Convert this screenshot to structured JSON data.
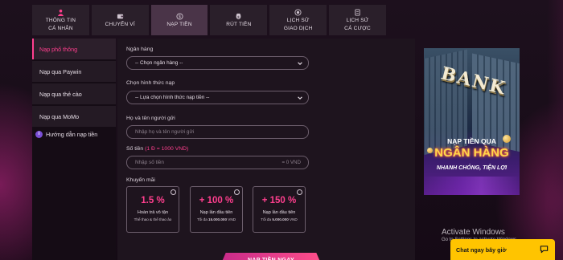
{
  "tabs": [
    {
      "icon": "user-icon",
      "label_line1": "THÔNG TIN",
      "label_line2": "CÁ NHÂN",
      "active": false
    },
    {
      "icon": "wallet-icon",
      "label_line1": "CHUYỂN VÍ",
      "label_line2": "",
      "active": false
    },
    {
      "icon": "deposit-icon",
      "label_line1": "NẠP TIỀN",
      "label_line2": "",
      "active": true
    },
    {
      "icon": "withdraw-icon",
      "label_line1": "RÚT TIỀN",
      "label_line2": "",
      "active": false
    },
    {
      "icon": "history-icon",
      "label_line1": "LỊCH SỬ",
      "label_line2": "GIAO DỊCH",
      "active": false
    },
    {
      "icon": "bet-history-icon",
      "label_line1": "LỊCH SỬ",
      "label_line2": "CÁ CƯỢC",
      "active": false
    }
  ],
  "sidebar": {
    "items": [
      {
        "label": "Nạp phổ thông",
        "active": true
      },
      {
        "label": "Nạp qua Paywin",
        "active": false
      },
      {
        "label": "Nạp qua thẻ cào",
        "active": false
      },
      {
        "label": "Nạp qua MoMo",
        "active": false
      }
    ],
    "guide_label": "Hướng dẫn nạp tiền",
    "guide_icon": "info-icon"
  },
  "form": {
    "bank_label": "Ngân hàng",
    "bank_value": "-- Chọn ngân hàng --",
    "method_label": "Chọn hình thức nạp",
    "method_value": "-- Lựa chọn hình thức nạp tiền --",
    "name_label": "Họ và tên người gửi",
    "name_placeholder": "Nhập họ và tên người gửi",
    "amount_label": "Số tiền",
    "amount_hint": "(1 Đ = 1000 VND)",
    "amount_placeholder": "Nhập số tiền",
    "amount_suffix": "= 0 VND",
    "promo_label": "Khuyến mãi",
    "submit_label": "NẠP TIỀN NGAY"
  },
  "promos": [
    {
      "value": "1.5 %",
      "title": "Hoàn trả vô tận",
      "subtitle": "Thể thao & thể thao ảo"
    },
    {
      "value": "+ 100 %",
      "title": "Nạp lần đầu tiên",
      "subtitle_prefix": "Tối đa ",
      "subtitle_amount": "15.000.000",
      "subtitle_suffix": " VND"
    },
    {
      "value": "+ 150 %",
      "title": "Nạp lần đầu tiên",
      "subtitle_prefix": "Tối đa ",
      "subtitle_amount": "5.000.000",
      "subtitle_suffix": " VND"
    }
  ],
  "banner": {
    "word": "BANK",
    "line1": "NẠP TIỀN QUA",
    "line2": "NGÂN HÀNG",
    "line3": "NHANH CHÓNG, TIỆN LỢI"
  },
  "windows": {
    "line1": "Activate Windows",
    "line2": "Go to Settings to activate Windows."
  },
  "chat": {
    "label": "Chat ngay bây giờ",
    "icon": "chat-bubble-icon"
  },
  "colors": {
    "accent": "#ff3f8e",
    "tab_active": "#4a3448",
    "chat_bg": "#ffc400"
  }
}
